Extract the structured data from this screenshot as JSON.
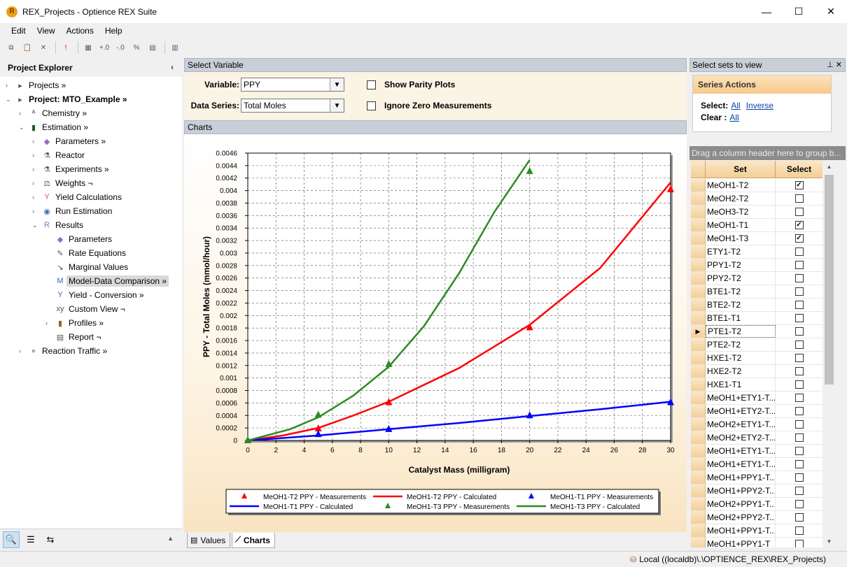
{
  "window": {
    "title": "REX_Projects - Optience REX Suite",
    "minimize": "—",
    "maximize": "☐",
    "close": "✕"
  },
  "menu": [
    "Edit",
    "View",
    "Actions",
    "Help"
  ],
  "toolbar_icons": [
    "copy-icon",
    "paste-icon",
    "delete-icon",
    "pin-icon",
    "table-icon",
    "add-decimal-icon",
    "remove-decimal-icon",
    "percent-icon",
    "export-icon",
    "properties-icon"
  ],
  "explorer": {
    "title": "Project Explorer",
    "items": [
      {
        "label": "Projects »",
        "level": 0,
        "arrow": "›",
        "icon": "projects-icon"
      },
      {
        "label": "Project: MTO_Example »",
        "level": 0,
        "arrow": "⌄",
        "icon": "project-icon",
        "bold": true
      },
      {
        "label": "Chemistry »",
        "level": 1,
        "arrow": "›",
        "icon": "chemistry-icon"
      },
      {
        "label": "Estimation »",
        "level": 1,
        "arrow": "⌄",
        "icon": "estimation-icon"
      },
      {
        "label": "Parameters »",
        "level": 2,
        "arrow": "›",
        "icon": "parameters-icon"
      },
      {
        "label": "Reactor",
        "level": 2,
        "arrow": "›",
        "icon": "reactor-icon"
      },
      {
        "label": "Experiments »",
        "level": 2,
        "arrow": "›",
        "icon": "experiments-icon"
      },
      {
        "label": "Weights ¬",
        "level": 2,
        "arrow": "›",
        "icon": "weights-icon"
      },
      {
        "label": "Yield Calculations",
        "level": 2,
        "arrow": "›",
        "icon": "yield-icon"
      },
      {
        "label": "Run Estimation",
        "level": 2,
        "arrow": "›",
        "icon": "run-icon"
      },
      {
        "label": "Results",
        "level": 2,
        "arrow": "⌄",
        "icon": "results-icon"
      },
      {
        "label": "Parameters",
        "level": 3,
        "arrow": "",
        "icon": "parameters-icon"
      },
      {
        "label": "Rate Equations",
        "level": 3,
        "arrow": "",
        "icon": "rate-equations-icon"
      },
      {
        "label": "Marginal Values",
        "level": 3,
        "arrow": "",
        "icon": "marginal-values-icon"
      },
      {
        "label": "Model-Data Comparison »",
        "level": 3,
        "arrow": "",
        "icon": "model-data-icon",
        "selected": true
      },
      {
        "label": "Yield - Conversion »",
        "level": 3,
        "arrow": "",
        "icon": "yield-conversion-icon"
      },
      {
        "label": "Custom View ¬",
        "level": 3,
        "arrow": "",
        "icon": "custom-view-icon"
      },
      {
        "label": "Profiles »",
        "level": 3,
        "arrow": "›",
        "icon": "profiles-icon"
      },
      {
        "label": "Report ¬",
        "level": 3,
        "arrow": "",
        "icon": "report-icon"
      },
      {
        "label": "Reaction Traffic »",
        "level": 1,
        "arrow": "›",
        "icon": "reaction-traffic-icon"
      }
    ]
  },
  "select_variable": {
    "header": "Select Variable",
    "variable_label": "Variable:",
    "variable_value": "PPY",
    "series_label": "Data Series:",
    "series_value": "Total Moles",
    "parity_label": "Show Parity Plots",
    "ignore_zero_label": "Ignore Zero Measurements"
  },
  "charts_header": "Charts",
  "chart_data": {
    "type": "line",
    "title": "",
    "xlabel": "Catalyst Mass (milligram)",
    "ylabel": "PPY - Total Moles (mmol/hour)",
    "xlim": [
      0,
      30
    ],
    "ylim": [
      0,
      0.0046
    ],
    "x_ticks": [
      "0",
      "2",
      "4",
      "6",
      "8",
      "10",
      "12",
      "14",
      "16",
      "18",
      "20",
      "22",
      "24",
      "26",
      "28",
      "30"
    ],
    "y_ticks": [
      "0",
      "0.0002",
      "0.0004",
      "0.0006",
      "0.0008",
      "0.001",
      "0.0012",
      "0.0014",
      "0.0016",
      "0.0018",
      "0.002",
      "0.0022",
      "0.0024",
      "0.0026",
      "0.0028",
      "0.003",
      "0.0032",
      "0.0034",
      "0.0036",
      "0.0038",
      "0.004",
      "0.0042",
      "0.0044",
      "0.0046"
    ],
    "grid": true,
    "legend_position": "bottom",
    "series": [
      {
        "name": "MeOH1-T2 PPY - Measurements",
        "kind": "markers",
        "color": "#ff0000",
        "x": [
          0,
          5,
          10,
          20,
          30
        ],
        "y": [
          0,
          0.00019,
          0.00061,
          0.00181,
          0.00402
        ]
      },
      {
        "name": "MeOH1-T2 PPY - Calculated",
        "kind": "line",
        "color": "#ff0000",
        "x": [
          0,
          2.5,
          5,
          7.5,
          10,
          15,
          20,
          25,
          30
        ],
        "y": [
          0,
          8e-05,
          0.0002,
          0.0004,
          0.00062,
          0.00116,
          0.00185,
          0.00276,
          0.00413
        ]
      },
      {
        "name": "MeOH1-T1 PPY - Measurements",
        "kind": "markers",
        "color": "#0000ff",
        "x": [
          0,
          5,
          10,
          20,
          30
        ],
        "y": [
          0,
          0.0001,
          0.00018,
          0.0004,
          0.00061
        ]
      },
      {
        "name": "MeOH1-T1 PPY - Calculated",
        "kind": "line",
        "color": "#0000ff",
        "x": [
          0,
          5,
          10,
          15,
          20,
          25,
          30
        ],
        "y": [
          0,
          8e-05,
          0.00018,
          0.00028,
          0.00039,
          0.0005,
          0.00062
        ]
      },
      {
        "name": "MeOH1-T3 PPY - Measurements",
        "kind": "markers",
        "color": "#2e8b23",
        "x": [
          0,
          5,
          10,
          20
        ],
        "y": [
          0,
          0.00041,
          0.00122,
          0.00431
        ]
      },
      {
        "name": "MeOH1-T3 PPY - Calculated",
        "kind": "line",
        "color": "#2e8b23",
        "x": [
          0,
          3,
          5,
          7.5,
          10,
          12.5,
          15,
          17.5,
          20
        ],
        "y": [
          0,
          0.00018,
          0.00037,
          0.00072,
          0.00118,
          0.00183,
          0.00268,
          0.00366,
          0.00449
        ]
      }
    ]
  },
  "bottom_tabs": [
    {
      "label": "Values",
      "icon": "values-icon"
    },
    {
      "label": "Charts",
      "icon": "charts-icon",
      "active": true
    }
  ],
  "right_panel": {
    "title": "Select sets to view",
    "series_actions": "Series Actions",
    "select_label": "Select:",
    "select_all": "All",
    "select_inverse": "Inverse",
    "clear_label": "Clear :",
    "clear_all": "All",
    "group_hint": "Drag a column header here to group b...",
    "col_set": "Set",
    "col_select": "Select",
    "rows": [
      {
        "set": "MeOH1-T2",
        "checked": true
      },
      {
        "set": "MeOH2-T2",
        "checked": false
      },
      {
        "set": "MeOH3-T2",
        "checked": false
      },
      {
        "set": "MeOH1-T1",
        "checked": true
      },
      {
        "set": "MeOH1-T3",
        "checked": true
      },
      {
        "set": "ETY1-T2",
        "checked": false
      },
      {
        "set": "PPY1-T2",
        "checked": false
      },
      {
        "set": "PPY2-T2",
        "checked": false
      },
      {
        "set": "BTE1-T2",
        "checked": false
      },
      {
        "set": "BTE2-T2",
        "checked": false
      },
      {
        "set": "BTE1-T1",
        "checked": false
      },
      {
        "set": "PTE1-T2",
        "checked": false,
        "current": true
      },
      {
        "set": "PTE2-T2",
        "checked": false
      },
      {
        "set": "HXE1-T2",
        "checked": false
      },
      {
        "set": "HXE2-T2",
        "checked": false
      },
      {
        "set": "HXE1-T1",
        "checked": false
      },
      {
        "set": "MeOH1+ETY1-T...",
        "checked": false
      },
      {
        "set": "MeOH1+ETY2-T...",
        "checked": false
      },
      {
        "set": "MeOH2+ETY1-T...",
        "checked": false
      },
      {
        "set": "MeOH2+ETY2-T...",
        "checked": false
      },
      {
        "set": "MeOH1+ETY1-T...",
        "checked": false
      },
      {
        "set": "MeOH1+ETY1-T...",
        "checked": false
      },
      {
        "set": "MeOH1+PPY1-T...",
        "checked": false
      },
      {
        "set": "MeOH1+PPY2-T...",
        "checked": false
      },
      {
        "set": "MeOH2+PPY1-T...",
        "checked": false
      },
      {
        "set": "MeOH2+PPY2-T...",
        "checked": false
      },
      {
        "set": "MeOH1+PPY1-T...",
        "checked": false
      },
      {
        "set": "MeOH1+PPY1-T",
        "checked": false
      }
    ]
  },
  "status": {
    "connection": "Local ((localdb)\\.\\OPTIENCE_REX\\REX_Projects)"
  }
}
